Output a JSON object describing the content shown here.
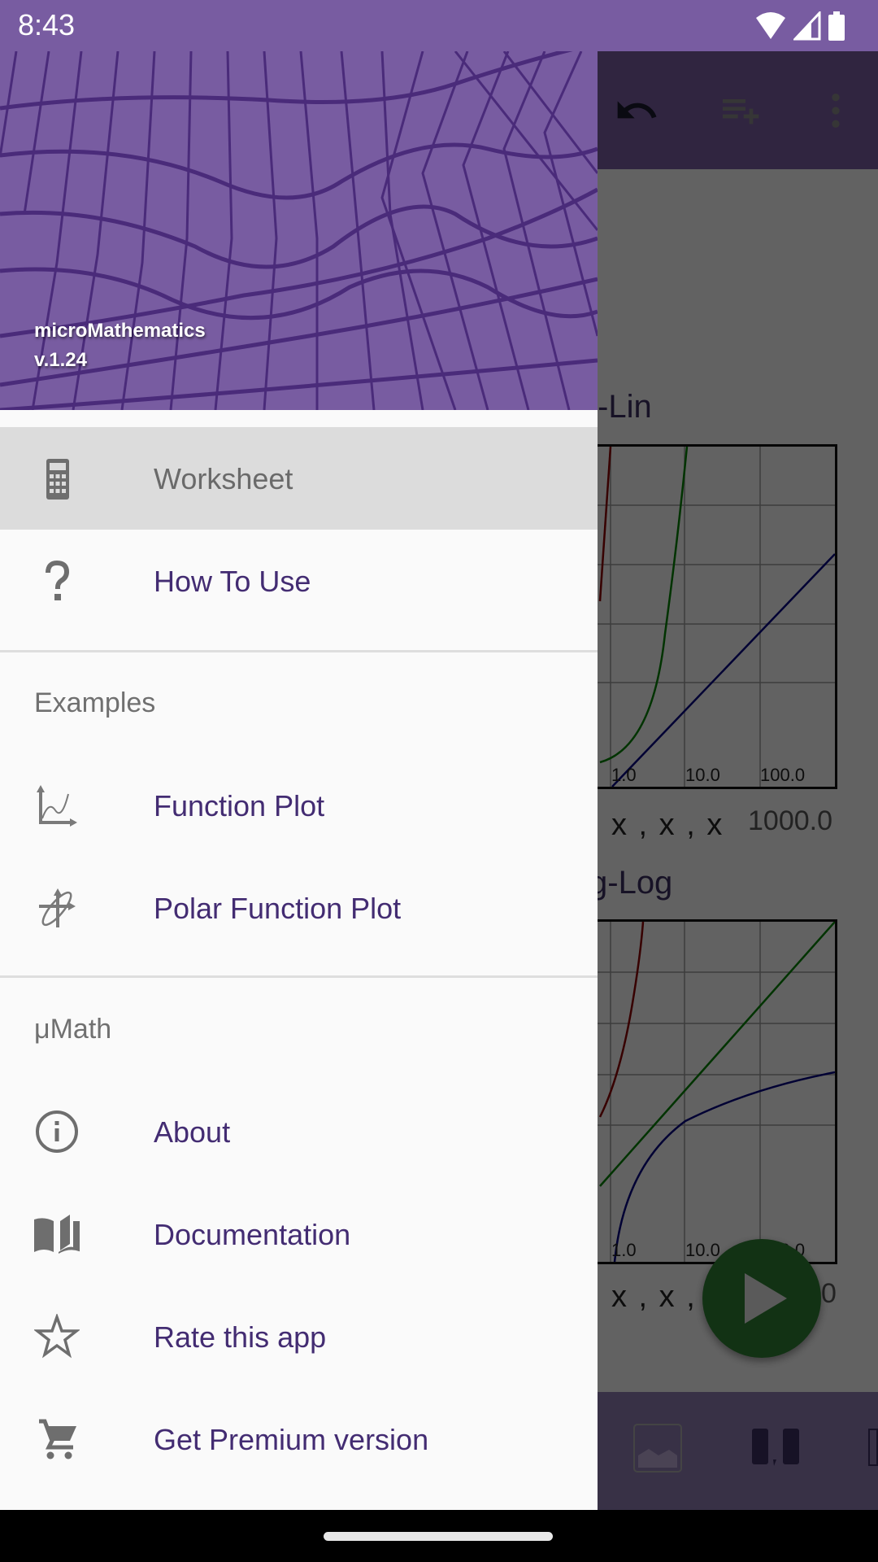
{
  "status_bar": {
    "time": "8:43",
    "icons": [
      "wifi-icon",
      "signal-icon",
      "battery-icon"
    ]
  },
  "background_app": {
    "toolbar_icons": [
      "undo-icon",
      "add-list-icon",
      "more-vert-icon"
    ],
    "plots": [
      {
        "title_partial": "-Lin",
        "x_ticks": [
          "1.0",
          "10.0",
          "100.0"
        ],
        "x_label": "x , x , x",
        "x_max": "1000.0",
        "series_colors": [
          "#8b0000",
          "#008000",
          "#000080"
        ]
      },
      {
        "title_partial": "g-Log",
        "x_ticks": [
          "1.0",
          "10.0",
          "100.0"
        ],
        "x_label": "x , x , x",
        "x_max": "0",
        "series_colors": [
          "#8b0000",
          "#008000",
          "#000080"
        ]
      }
    ],
    "fab_icon": "play-icon",
    "bottom_icons": [
      "image-icon",
      "list-separator-icon",
      "bracket-icon"
    ]
  },
  "drawer": {
    "header": {
      "app_name": "microMathematics",
      "version": "v.1.24"
    },
    "top_items": [
      {
        "label": "Worksheet",
        "icon": "calculator-icon",
        "selected": true
      },
      {
        "label": "How To Use",
        "icon": "help-icon",
        "selected": false
      }
    ],
    "sections": [
      {
        "title": "Examples",
        "items": [
          {
            "label": "Function Plot",
            "icon": "function-plot-icon"
          },
          {
            "label": "Polar Function Plot",
            "icon": "polar-plot-icon"
          }
        ]
      },
      {
        "title": "μMath",
        "items": [
          {
            "label": "About",
            "icon": "info-icon"
          },
          {
            "label": "Documentation",
            "icon": "book-icon"
          },
          {
            "label": "Rate this app",
            "icon": "star-icon"
          },
          {
            "label": "Get Premium version",
            "icon": "cart-icon"
          }
        ]
      }
    ]
  },
  "colors": {
    "primary": "#785ca1",
    "menu_text": "#432c72",
    "selected_bg": "#dcdcdc",
    "fab": "#2e7d32"
  }
}
